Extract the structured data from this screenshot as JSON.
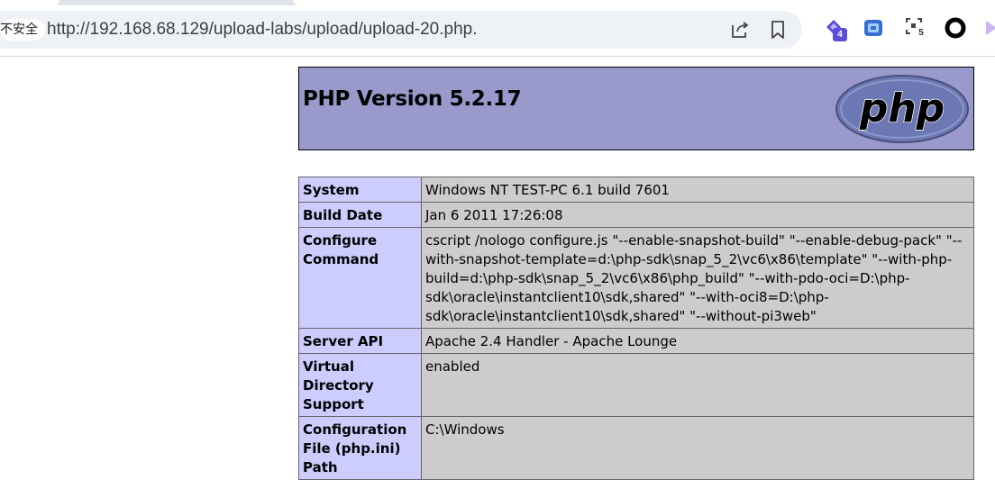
{
  "browser": {
    "security_label": "不安全",
    "url": "http://192.168.68.129/upload-labs/upload/upload-20.php.",
    "extensions": [
      {
        "icon": "diamond-extension-icon",
        "badge": "4",
        "color": "#5a4fd6"
      },
      {
        "icon": "image-extension-icon",
        "badge": "",
        "color": "#3b6cd6"
      },
      {
        "icon": "screenshot-extension-icon",
        "badge": "5",
        "color": "#444444"
      },
      {
        "icon": "circle-extension-icon",
        "badge": "",
        "color": "#000000"
      }
    ]
  },
  "phpinfo": {
    "title": "PHP Version 5.2.17",
    "logo_text": "php",
    "rows": [
      {
        "key": "System",
        "value": "Windows NT TEST-PC 6.1 build 7601"
      },
      {
        "key": "Build Date",
        "value": "Jan 6 2011 17:26:08"
      },
      {
        "key": "Configure Command",
        "value": "cscript /nologo configure.js \"--enable-snapshot-build\" \"--enable-debug-pack\" \"--with-snapshot-template=d:\\php-sdk\\snap_5_2\\vc6\\x86\\template\" \"--with-php-build=d:\\php-sdk\\snap_5_2\\vc6\\x86\\php_build\" \"--with-pdo-oci=D:\\php-sdk\\oracle\\instantclient10\\sdk,shared\" \"--with-oci8=D:\\php-sdk\\oracle\\instantclient10\\sdk,shared\" \"--without-pi3web\""
      },
      {
        "key": "Server API",
        "value": "Apache 2.4 Handler - Apache Lounge"
      },
      {
        "key": "Virtual Directory Support",
        "value": "enabled"
      },
      {
        "key": "Configuration File (php.ini) Path",
        "value": "C:\\Windows"
      }
    ]
  },
  "colors": {
    "header_bg": "#9999cc",
    "key_bg": "#ccccff",
    "value_bg": "#cccccc"
  }
}
